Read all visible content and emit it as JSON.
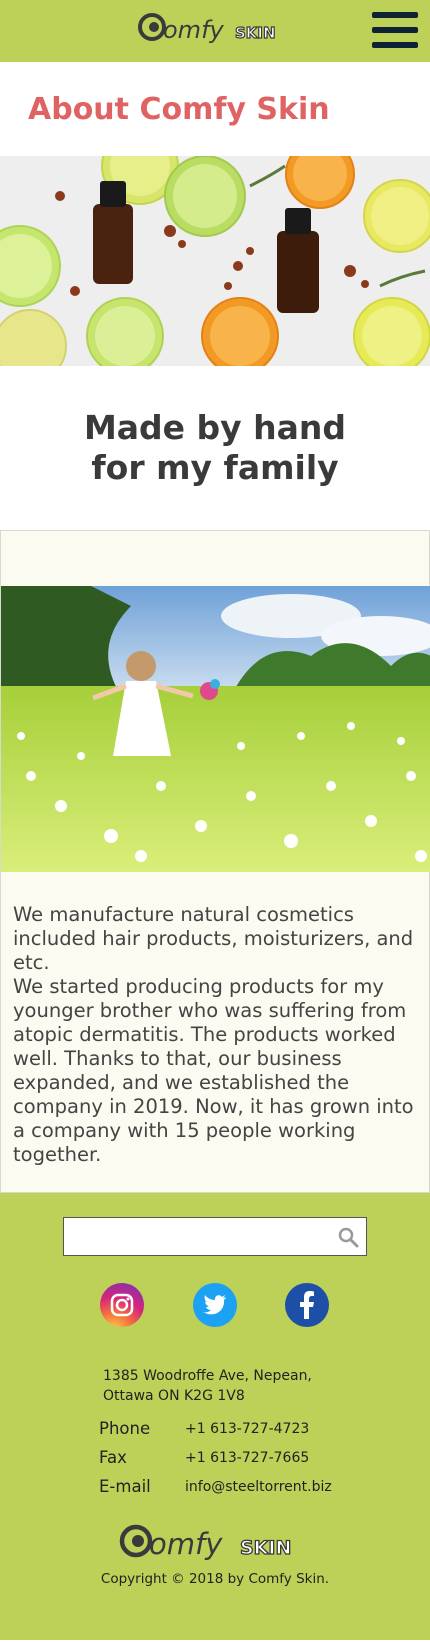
{
  "header": {
    "logo_text": "Comfy SKIN",
    "menu_icon": "hamburger-menu-icon"
  },
  "page": {
    "title": "About Comfy Skin",
    "subtitle_line1": "Made by hand",
    "subtitle_line2": "for my family"
  },
  "story": {
    "paragraph1": "We manufacture natural cosmetics included hair products, moisturizers, and etc.",
    "paragraph2": "We started producing products for my younger brother who was suffering from atopic dermatitis. The products worked well. Thanks to that, our business expanded, and we established the company in 2019. Now, it has grown into a company with 15 people working together."
  },
  "footer": {
    "search": {
      "value": "",
      "placeholder": "",
      "icon": "search-icon"
    },
    "social": [
      {
        "name": "instagram",
        "icon": "instagram-icon"
      },
      {
        "name": "twitter",
        "icon": "twitter-icon"
      },
      {
        "name": "facebook",
        "icon": "facebook-icon"
      }
    ],
    "address_line1": "1385 Woodroffe Ave, Nepean,",
    "address_line2": "Ottawa ON K2G 1V8",
    "phone_label": "Phone",
    "phone_value": "+1 613-727-4723",
    "fax_label": "Fax",
    "fax_value": "+1 613-727-7665",
    "email_label": "E-mail",
    "email_value": "info@steeltorrent.biz",
    "copyright": "Copyright © 2018 by Comfy Skin."
  },
  "colors": {
    "brand_green": "#bdd158",
    "title_red": "#e06363",
    "menu_navy": "#0f2233",
    "story_bg": "#fbfbf1"
  }
}
